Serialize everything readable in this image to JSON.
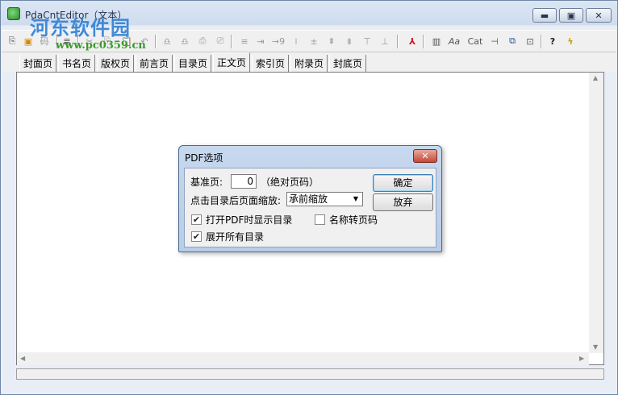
{
  "window": {
    "title": "PdaCntEditor（文本）",
    "minimize_label": "▬",
    "maximize_label": "▣",
    "close_label": "✕"
  },
  "watermark": {
    "text": "河东软件园",
    "url": "www.pc0359.cn"
  },
  "toolbar": {
    "buttons": [
      {
        "icon": "new-document-icon",
        "glyph": "⎘"
      },
      {
        "icon": "save-icon",
        "glyph": "▣"
      },
      {
        "icon": "code-icon",
        "glyph": "码"
      },
      {
        "icon": "outline-icon",
        "glyph": "≣"
      },
      {
        "icon": "cut-icon",
        "glyph": "✂"
      },
      {
        "icon": "copy-icon",
        "glyph": "⎘"
      },
      {
        "icon": "paste-icon",
        "glyph": "📋"
      },
      {
        "icon": "undo-icon",
        "glyph": "↶"
      },
      {
        "icon": "find-icon",
        "glyph": "♎"
      },
      {
        "icon": "find-next-icon",
        "glyph": "♎"
      },
      {
        "icon": "insert-page-icon",
        "glyph": "⎙"
      },
      {
        "icon": "delete-page-icon",
        "glyph": "⎚"
      },
      {
        "icon": "align-left-icon",
        "glyph": "≡"
      },
      {
        "icon": "indent-icon",
        "glyph": "⇥"
      },
      {
        "icon": "number-icon",
        "glyph": "→9"
      },
      {
        "icon": "chart-icon",
        "glyph": "⁞"
      },
      {
        "icon": "plus-icon",
        "glyph": "±"
      },
      {
        "icon": "merge-up-icon",
        "glyph": "⇞"
      },
      {
        "icon": "merge-down-icon",
        "glyph": "⇟"
      },
      {
        "icon": "split-icon",
        "glyph": "⊤"
      },
      {
        "icon": "join-icon",
        "glyph": "⊥"
      },
      {
        "icon": "pdf-icon",
        "glyph": "⅄"
      },
      {
        "icon": "columns-icon",
        "glyph": "▥"
      },
      {
        "icon": "font-icon",
        "glyph": "Aa"
      },
      {
        "icon": "cat-icon",
        "glyph": "Cat"
      },
      {
        "icon": "insert-icon",
        "glyph": "⊣"
      },
      {
        "icon": "window-icon",
        "glyph": "⧉"
      },
      {
        "icon": "preview-icon",
        "glyph": "⊡"
      },
      {
        "icon": "help-icon",
        "glyph": "?"
      },
      {
        "icon": "lightning-icon",
        "glyph": "ϟ"
      }
    ]
  },
  "tabs": [
    {
      "label": "封面页"
    },
    {
      "label": "书名页"
    },
    {
      "label": "版权页"
    },
    {
      "label": "前言页"
    },
    {
      "label": "目录页"
    },
    {
      "label": "正文页"
    },
    {
      "label": "索引页"
    },
    {
      "label": "附录页"
    },
    {
      "label": "封底页"
    }
  ],
  "active_tab": "正文页",
  "dialog": {
    "title": "PDF选项",
    "close_label": "✕",
    "base_page_label": "基准页:",
    "base_page_value": "0",
    "base_page_note": "（绝对页码）",
    "zoom_label": "点击目录后页面缩放:",
    "zoom_value": "承前缩放",
    "ok_label": "确定",
    "cancel_label": "放弃",
    "checkboxes": [
      {
        "label": "打开PDF时显示目录",
        "checked": true
      },
      {
        "label": "名称转页码",
        "checked": false
      },
      {
        "label": "展开所有目录",
        "checked": true
      }
    ]
  }
}
